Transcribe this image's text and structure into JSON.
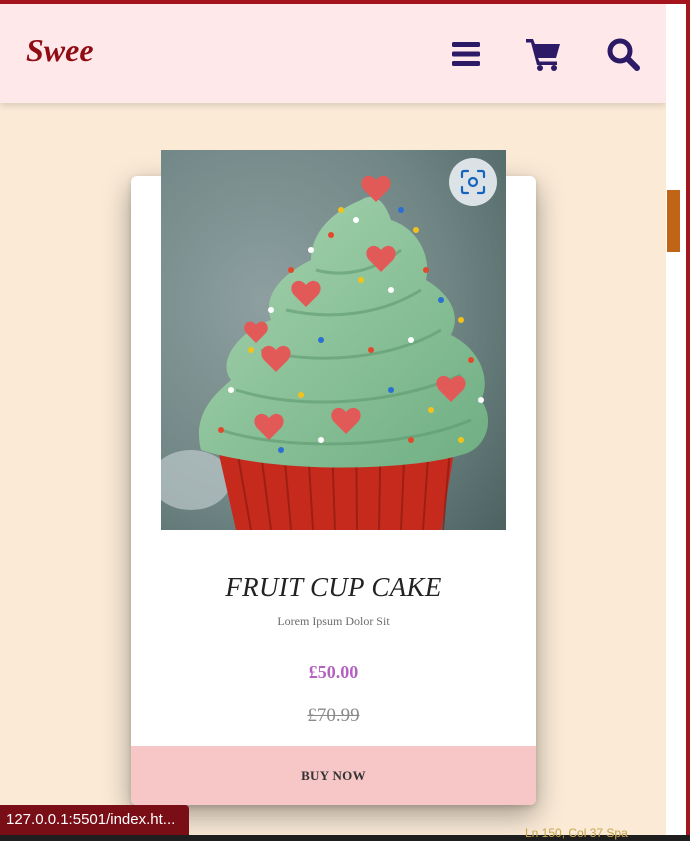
{
  "header": {
    "logo": "Swee",
    "icons": [
      "menu-icon",
      "cart-icon",
      "search-icon"
    ]
  },
  "product": {
    "title": "FRUIT CUP CAKE",
    "subtitle": "Lorem Ipsum Dolor Sit",
    "price_current": "£50.00",
    "price_old": "£70.99",
    "buy_label": "BUY NOW",
    "image_alt": "cupcake with green frosting, sprinkles and heart decorations",
    "lens_icon": "visual-search-icon"
  },
  "status_bar": {
    "url": "127.0.0.1:5501/index.ht...",
    "editor_fragment": "Ln 150, Col 37    Spa"
  },
  "colors": {
    "header_bg": "#ffe8ea",
    "page_bg": "#faead6",
    "logo": "#8e0c12",
    "icons": "#2d1a66",
    "price": "#b362c0",
    "buy_button_bg": "#f7c6c7",
    "frame": "#a5131d",
    "scroll_thumb": "#c06418"
  }
}
